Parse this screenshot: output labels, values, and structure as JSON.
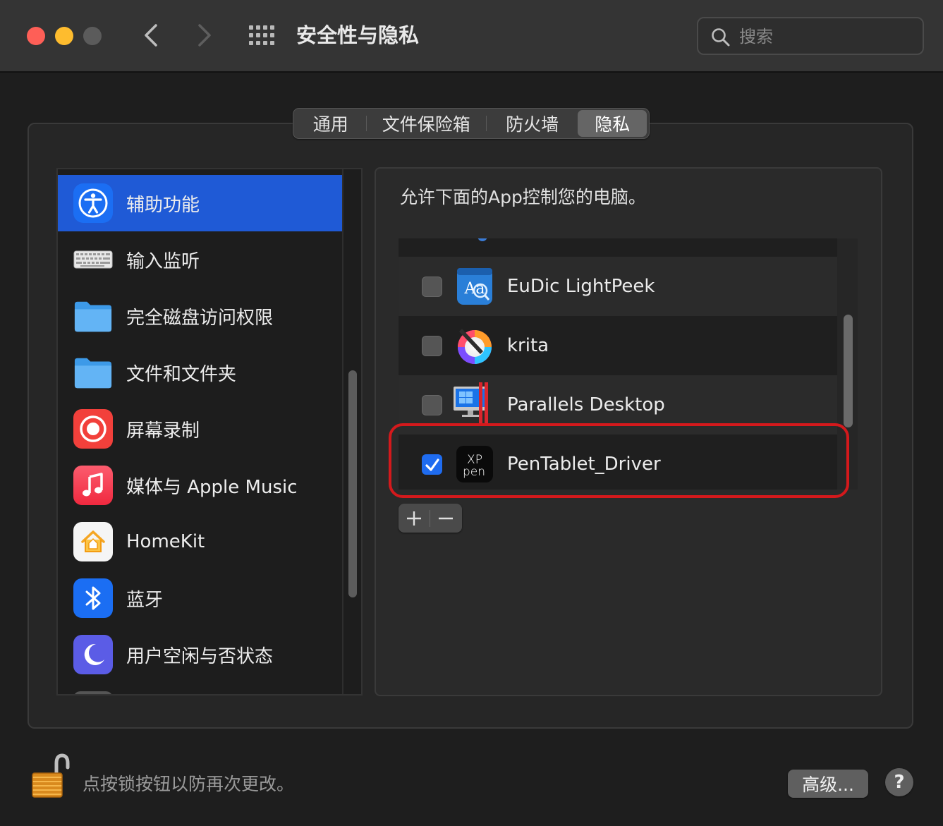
{
  "window": {
    "title": "安全性与隐私",
    "search_placeholder": "搜索"
  },
  "tabs": [
    {
      "label": "通用",
      "selected": false
    },
    {
      "label": "文件保险箱",
      "selected": false
    },
    {
      "label": "防火墙",
      "selected": false
    },
    {
      "label": "隐私",
      "selected": true
    }
  ],
  "sidebar": {
    "items": [
      {
        "label": "辅助功能",
        "icon": "accessibility-icon",
        "selected": true
      },
      {
        "label": "输入监听",
        "icon": "keyboard-icon",
        "selected": false
      },
      {
        "label": "完全磁盘访问权限",
        "icon": "folder-icon",
        "selected": false
      },
      {
        "label": "文件和文件夹",
        "icon": "folder-icon",
        "selected": false
      },
      {
        "label": "屏幕录制",
        "icon": "screen-record-icon",
        "selected": false
      },
      {
        "label": "媒体与 Apple Music",
        "icon": "music-note-icon",
        "selected": false
      },
      {
        "label": "HomeKit",
        "icon": "home-icon",
        "selected": false
      },
      {
        "label": "蓝牙",
        "icon": "bluetooth-icon",
        "selected": false
      },
      {
        "label": "用户空闲与否状态",
        "icon": "moon-icon",
        "selected": false
      }
    ]
  },
  "main": {
    "description": "允许下面的App控制您的电脑。",
    "apps": [
      {
        "name": "EuDic LightPeek",
        "checked": false,
        "icon": "eudic-icon"
      },
      {
        "name": "krita",
        "checked": false,
        "icon": "krita-icon"
      },
      {
        "name": "Parallels Desktop",
        "checked": false,
        "icon": "parallels-icon"
      },
      {
        "name": "PenTablet_Driver",
        "checked": true,
        "icon": "xppen-icon"
      }
    ],
    "add_label": "+",
    "remove_label": "−"
  },
  "footer": {
    "lock_text": "点按锁按钮以防再次更改。",
    "advanced_label": "高级...",
    "help_label": "?"
  },
  "colors": {
    "selection_blue": "#1f5ad6",
    "checkbox_blue": "#1f6cf0",
    "highlight_red": "#d4191c"
  }
}
